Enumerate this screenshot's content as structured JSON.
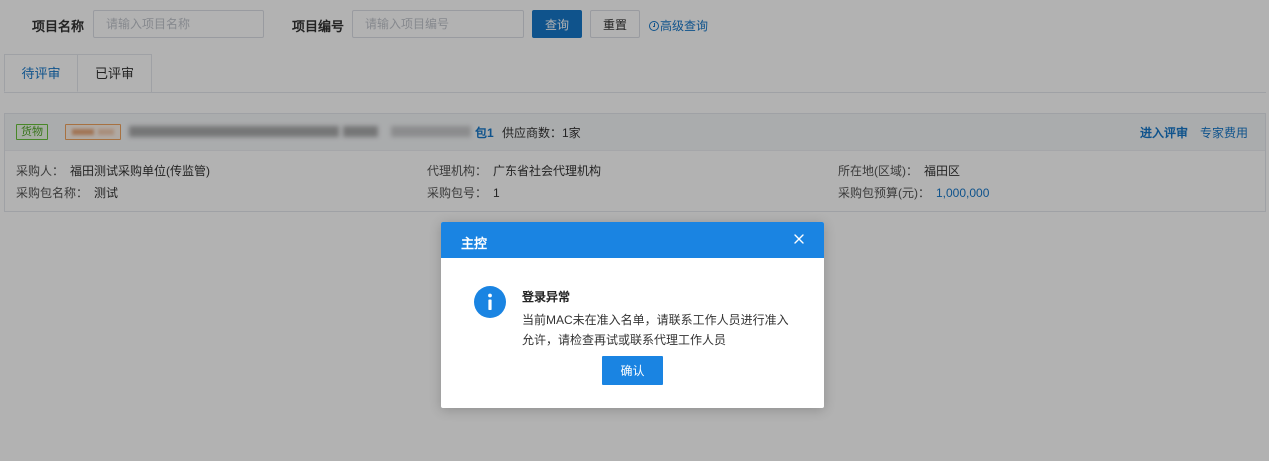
{
  "search": {
    "name_label": "项目名称",
    "name_placeholder": "请输入项目名称",
    "code_label": "项目编号",
    "code_placeholder": "请输入项目编号",
    "query_label": "查询",
    "reset_label": "重置",
    "advanced_label": "高级查询"
  },
  "tabs": [
    {
      "label": "待评审",
      "active": true
    },
    {
      "label": "已评审",
      "active": false
    }
  ],
  "card": {
    "tag_category": "货物",
    "package_label": "包1",
    "supplier_count": "供应商数：1家",
    "enter_review": "进入评审",
    "expert_fee": "专家费用",
    "purchaser_label": "采购人：",
    "purchaser_value": "福田测试采购单位(传监管)",
    "agency_label": "代理机构：",
    "agency_value": "广东省社会代理机构",
    "location_label": "所在地(区域)：",
    "location_value": "福田区",
    "package_name_label": "采购包名称：",
    "package_name_value": "测试",
    "package_no_label": "采购包号：",
    "package_no_value": "1",
    "budget_label": "采购包预算(元)：",
    "budget_value": "1,000,000"
  },
  "modal": {
    "title": "主控",
    "message_title": "登录异常",
    "message_body": "当前MAC未在准入名单，请联系工作人员进行准入允许，请检查再试或联系代理工作人员",
    "confirm_label": "确认"
  },
  "colors": {
    "primary": "#1677c9",
    "modal_header": "#1a84e2",
    "tag_green": "#67c23a",
    "tag_orange": "#f0a35e"
  },
  "icons": {
    "close": "close-icon",
    "info": "info-icon"
  }
}
